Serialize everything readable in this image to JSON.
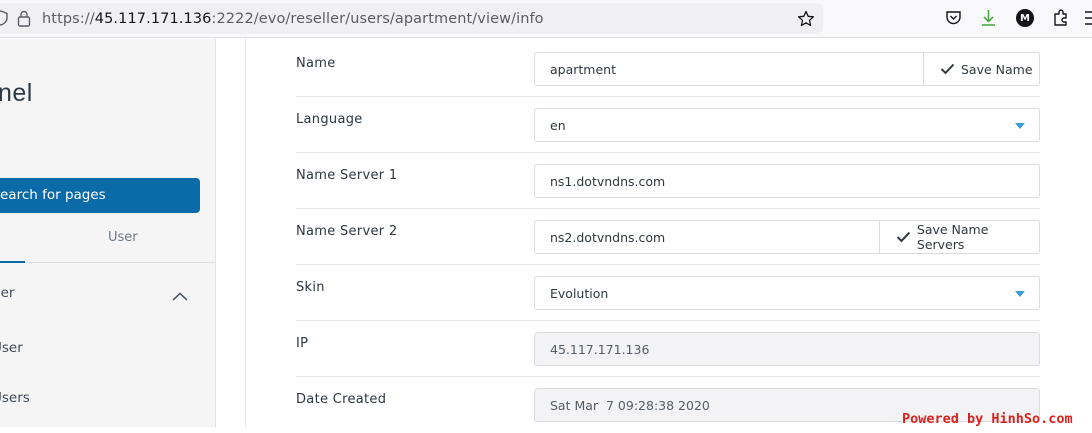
{
  "browser": {
    "url_scheme": "https://",
    "url_host": "45.117.171.136",
    "url_rest": ":2222/evo/reseller/users/apartment/view/info",
    "icons": [
      "shield-icon",
      "lock-icon",
      "bookmark-star-icon",
      "pocket-icon",
      "download-icon",
      "account-icon",
      "extensions-icon",
      "menu-icon"
    ],
    "account_initial": "M"
  },
  "sidebar": {
    "brand": "nel",
    "search_label": "earch for pages",
    "tab_user": "User",
    "menu_head": "ger",
    "items": [
      "User",
      "Users"
    ]
  },
  "form": {
    "name_label": "Name",
    "name_value": "apartment",
    "save_name_label": "Save Name",
    "language_label": "Language",
    "language_value": "en",
    "ns1_label": "Name Server 1",
    "ns1_value": "ns1.dotvndns.com",
    "ns2_label": "Name Server 2",
    "ns2_value": "ns2.dotvndns.com",
    "save_ns_label": "Save Name Servers",
    "skin_label": "Skin",
    "skin_value": "Evolution",
    "ip_label": "IP",
    "ip_value": "45.117.171.136",
    "date_label": "Date Created",
    "date_value": "Sat Mar  7 09:28:38 2020"
  },
  "colors": {
    "accent": "#0b6aa8",
    "caret": "#3d9ad8",
    "download": "#3fa535"
  },
  "watermark": "Powered by HinhSo.com"
}
